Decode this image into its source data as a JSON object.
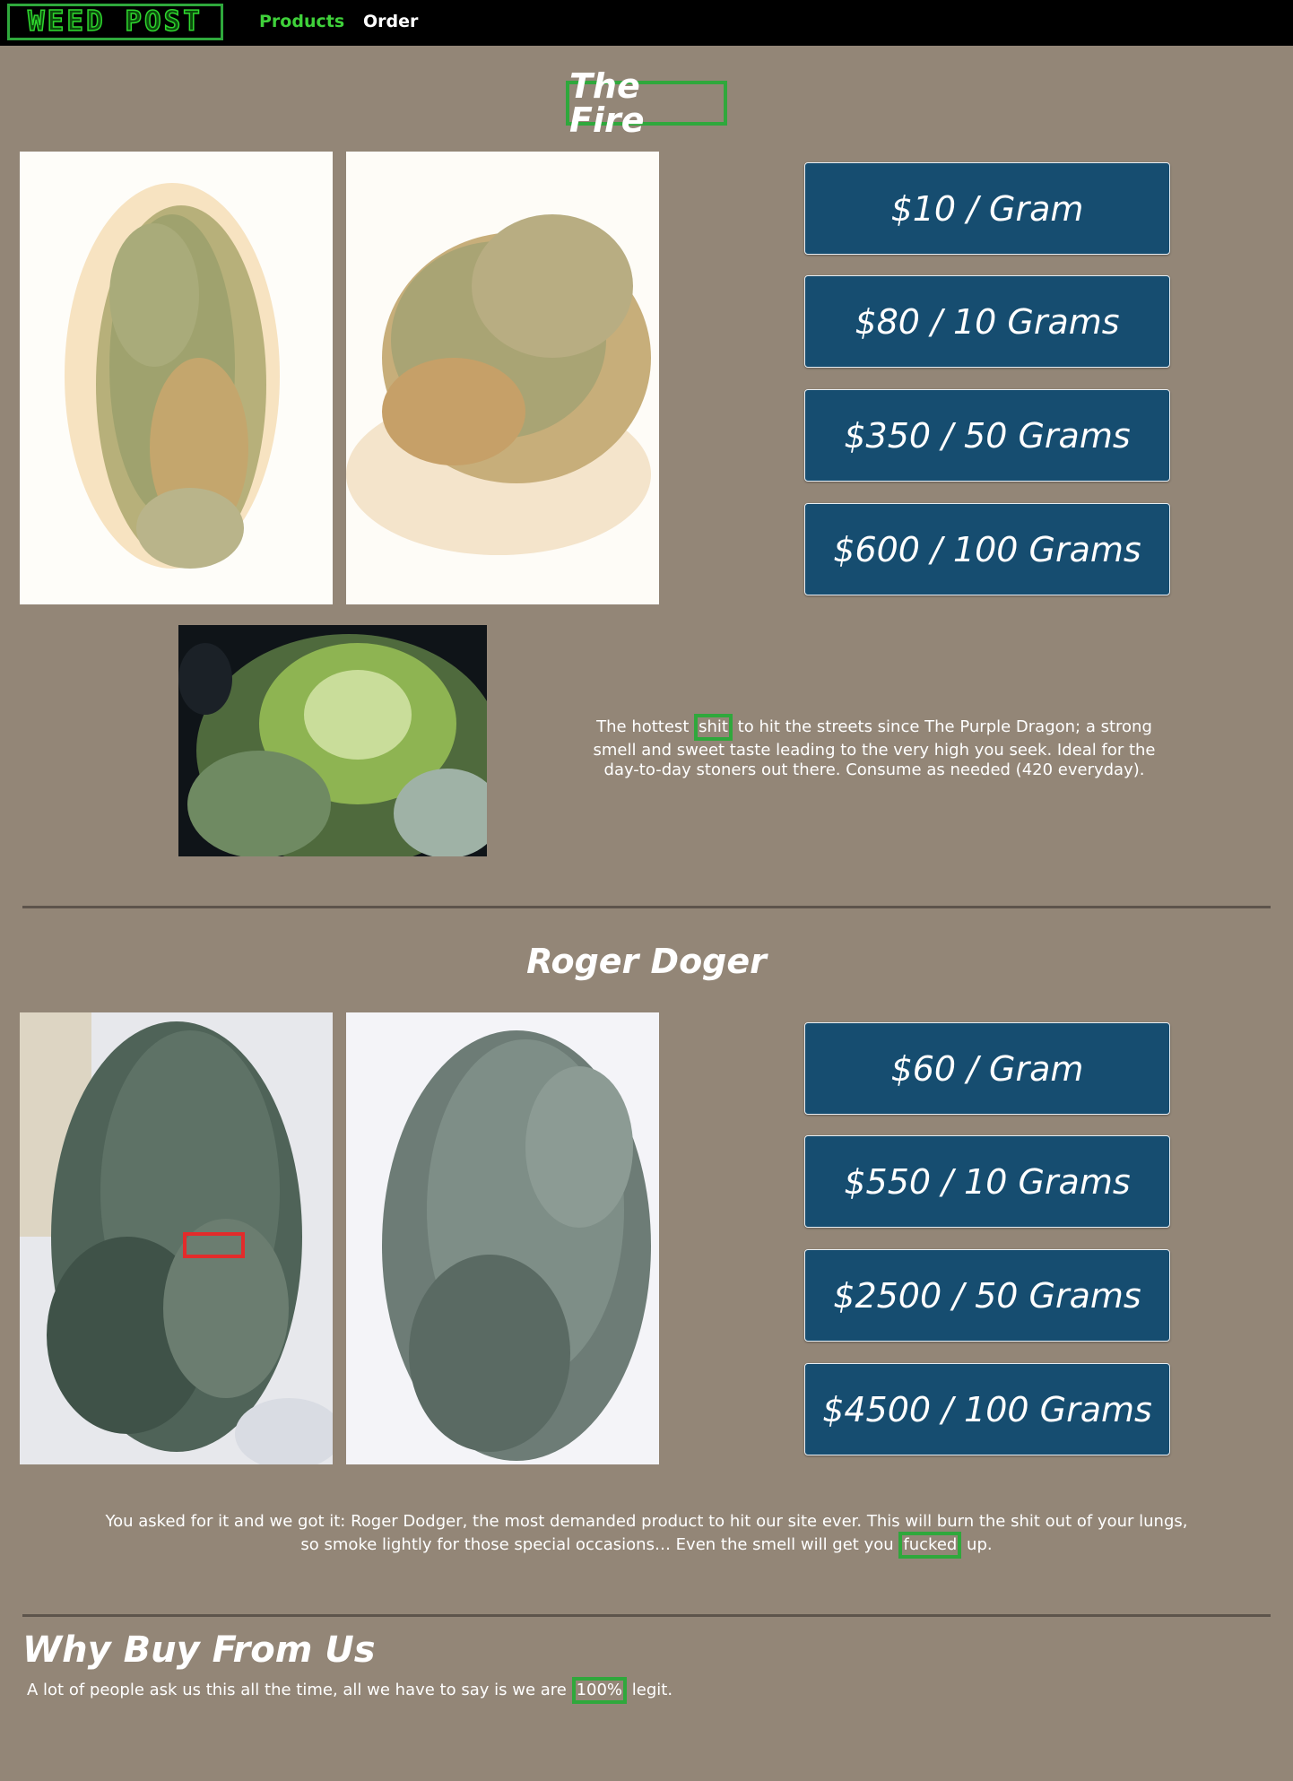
{
  "nav": {
    "logo_text": "WEED POST",
    "products_label": "Products",
    "order_label": "Order"
  },
  "products": [
    {
      "title": "The Fire",
      "prices": [
        "$10 / Gram",
        "$80 / 10 Grams",
        "$350 / 50 Grams",
        "$600 / 100 Grams"
      ],
      "description": {
        "part1": "The hottest ",
        "highlight": "shit",
        "part2": " to hit the streets since The Purple Dragon; a strong smell and sweet taste leading to the very high you seek. Ideal for the day-to-day stoners out there. Consume as needed (420 everyday)."
      }
    },
    {
      "title": "Roger Doger",
      "prices": [
        "$60 / Gram",
        "$550 / 10 Grams",
        "$2500 / 50 Grams",
        "$4500 / 100 Grams"
      ],
      "description": {
        "part1": "You asked for it and we got it: Roger Dodger, the most demanded product to hit our site ever. This will burn the shit out of your lungs, so smoke lightly for those special occasions… Even the smell will get you ",
        "highlight": "fucked",
        "part2": " up."
      }
    }
  ],
  "why": {
    "title": "Why Buy From Us",
    "text_part1": "A lot of people ask us this all the time, all we have to say is we are ",
    "highlight": "100%",
    "text_part2": " legit."
  },
  "colors": {
    "background": "#938677",
    "button": "#164d70",
    "highlight_border": "#2fa83c",
    "nav_active": "#3fd13a"
  }
}
